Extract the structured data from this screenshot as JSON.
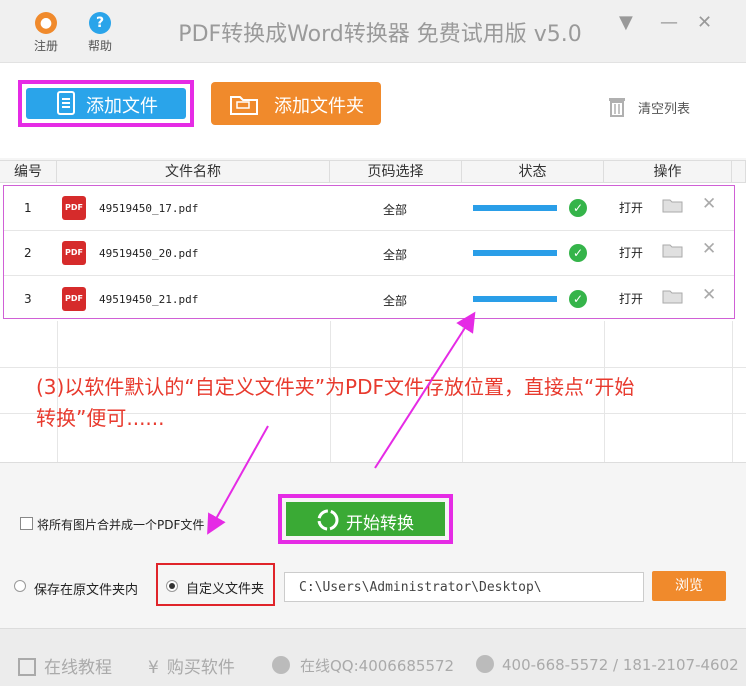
{
  "titlebar": {
    "register_label": "注册",
    "help_label": "帮助",
    "title": "PDF转换成Word转换器 免费试用版 v5.0",
    "minimize_glyph": "▼",
    "tray_glyph": "—",
    "close_glyph": "✕"
  },
  "toolbar": {
    "add_file_label": "添加文件",
    "add_folder_label": "添加文件夹",
    "clear_list_label": "清空列表"
  },
  "table": {
    "headers": [
      "编号",
      "文件名称",
      "页码选择",
      "状态",
      "操作"
    ],
    "rows": [
      {
        "index": "1",
        "filename": "49519450_17.pdf",
        "pages": "全部",
        "progress": 1.0,
        "open_label": "打开"
      },
      {
        "index": "2",
        "filename": "49519450_20.pdf",
        "pages": "全部",
        "progress": 1.0,
        "open_label": "打开"
      },
      {
        "index": "3",
        "filename": "49519450_21.pdf",
        "pages": "全部",
        "progress": 1.0,
        "open_label": "打开"
      }
    ],
    "pdf_icon_text": "PDF"
  },
  "annotation": {
    "line1": "(3)以软件默认的“自定义文件夹”为PDF文件存放位置，直接点“开始",
    "line2": "转换”便可......"
  },
  "options": {
    "merge_images_label": "将所有图片合并成一个PDF文件",
    "start_label": "开始转换",
    "save_original_label": "保存在原文件夹内",
    "custom_folder_label": "自定义文件夹",
    "path_value": "C:\\Users\\Administrator\\Desktop\\",
    "browse_label": "浏览"
  },
  "footer": {
    "tutorial_label": "在线教程",
    "buy_label": "购买软件",
    "qq_label": "在线QQ:4006685572",
    "phone_label": "400-668-5572 / 181-2107-4602"
  },
  "colors": {
    "highlight": "#e52be5",
    "annotation_text": "#e83a2e",
    "blue_button": "#2aa4ea",
    "orange_button": "#f08a2c",
    "green_button": "#3aaa35",
    "progress": "#2a9ee8"
  }
}
